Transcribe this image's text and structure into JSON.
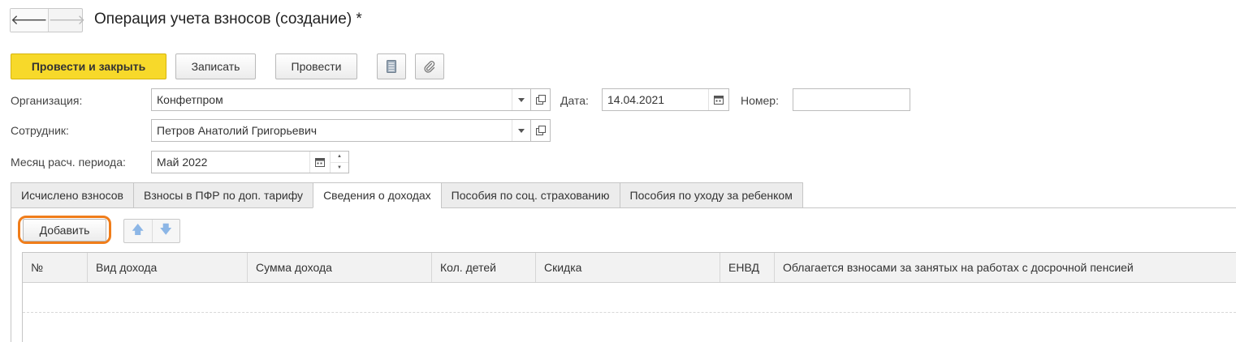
{
  "nav": {
    "back_glyph": "🡐",
    "forward_glyph": "🡒"
  },
  "window": {
    "title": "Операция учета взносов (создание) *"
  },
  "toolbar": {
    "post_and_close": "Провести и закрыть",
    "save": "Записать",
    "post": "Провести",
    "icons": [
      "report-icon",
      "paperclip-icon"
    ]
  },
  "form": {
    "organization_label": "Организация:",
    "organization_value": "Конфетпром",
    "date_label": "Дата:",
    "date_value": "14.04.2021",
    "number_label": "Номер:",
    "number_value": "",
    "employee_label": "Сотрудник:",
    "employee_value": "Петров Анатолий Григорьевич",
    "period_label": "Месяц расч. периода:",
    "period_value": "Май 2022"
  },
  "tabs": [
    {
      "label": "Исчислено взносов",
      "active": false
    },
    {
      "label": "Взносы в ПФР по доп. тарифу",
      "active": false
    },
    {
      "label": "Сведения о доходах",
      "active": true
    },
    {
      "label": "Пособия по соц. страхованию",
      "active": false
    },
    {
      "label": "Пособия по уходу за ребенком",
      "active": false
    }
  ],
  "table_toolbar": {
    "add": "Добавить",
    "up_glyph": "🡅",
    "down_glyph": "🡇"
  },
  "table": {
    "columns": [
      "№",
      "Вид дохода",
      "Сумма дохода",
      "Кол. детей",
      "Скидка",
      "ЕНВД",
      "Облагается взносами за занятых на работах с досрочной пенсией"
    ],
    "rows": []
  },
  "colors": {
    "primary": "#f7d92a",
    "highlight": "#f07d1a",
    "arrow": "#8cb6e6"
  }
}
